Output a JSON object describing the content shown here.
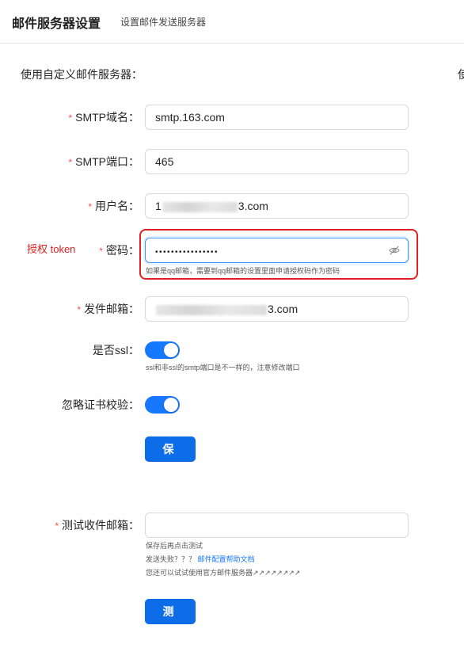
{
  "header": {
    "title": "邮件服务器设置",
    "subtitle": "设置邮件发送服务器"
  },
  "form": {
    "custom_server_label": "使用自定义邮件服务器：",
    "custom_server_label_right": "使",
    "required_mark": "*",
    "smtp_host": {
      "label": "SMTP域名：",
      "value": "smtp.163.com"
    },
    "smtp_port": {
      "label": "SMTP端口：",
      "value": "465"
    },
    "username": {
      "label": "用户名：",
      "value_prefix": "1",
      "value_suffix": "3.com"
    },
    "password": {
      "label": "密码：",
      "value": "••••••••••••••••",
      "help": "如果是qq邮箱，需要到qq邮箱的设置里面申请授权码作为密码",
      "eye_icon": "eye-invisible-icon"
    },
    "sender": {
      "label": "发件邮箱：",
      "value_prefix": "",
      "value_suffix": "3.com"
    },
    "ssl": {
      "label": "是否ssl：",
      "on": true,
      "help": "ssl和非ssl的smtp端口是不一样的，注意修改端口"
    },
    "ignore_cert": {
      "label": "忽略证书校验：",
      "on": true
    },
    "save_button": "保存",
    "test_email": {
      "label": "测试收件邮箱：",
      "value": "",
      "help_line1": "保存后再点击测试",
      "help_line2_prefix": "发送失败？？？",
      "help_line2_link": "邮件配置帮助文档",
      "help_line3": "您还可以试试使用官方邮件服务器↗↗↗↗↗↗↗↗"
    },
    "test_button": "测试"
  },
  "annotation": {
    "text": "授权 token",
    "color": "#e02020"
  },
  "colors": {
    "primary": "#1677ff",
    "button": "#0d6de8",
    "required": "#ff4d4f"
  }
}
